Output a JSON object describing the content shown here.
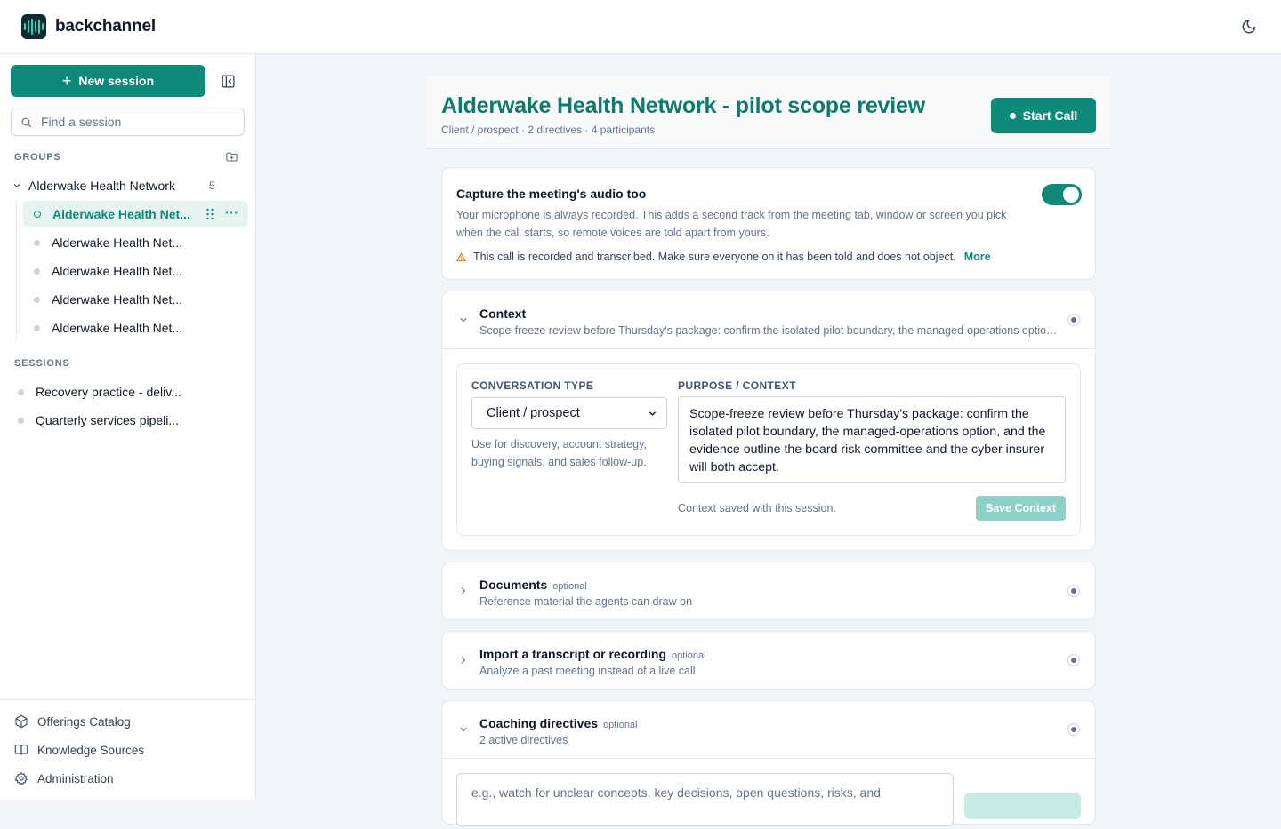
{
  "app": {
    "name": "backchannel"
  },
  "sidebar": {
    "new_session_label": "New session",
    "search_placeholder": "Find a session",
    "groups_label": "GROUPS",
    "group": {
      "name": "Alderwake Health Network",
      "count": "5",
      "sessions": [
        {
          "label": "Alderwake Health Net...",
          "active": true
        },
        {
          "label": "Alderwake Health Net...",
          "active": false
        },
        {
          "label": "Alderwake Health Net...",
          "active": false
        },
        {
          "label": "Alderwake Health Net...",
          "active": false
        },
        {
          "label": "Alderwake Health Net...",
          "active": false
        }
      ]
    },
    "sessions_label": "SESSIONS",
    "sessions": [
      {
        "label": "Recovery practice - deliv..."
      },
      {
        "label": "Quarterly services pipeli..."
      }
    ],
    "footer": [
      {
        "label": "Offerings Catalog",
        "icon": "package-icon"
      },
      {
        "label": "Knowledge Sources",
        "icon": "book-icon"
      },
      {
        "label": "Administration",
        "icon": "gear-icon"
      }
    ]
  },
  "main": {
    "title": "Alderwake Health Network - pilot scope review",
    "subtitle": "Client / prospect · 2 directives · 4 participants",
    "start_call_label": "Start Call",
    "audio": {
      "title": "Capture the meeting's audio too",
      "description": "Your microphone is always recorded. This adds a second track from the meeting tab, window or screen you pick when the call starts, so remote voices are told apart from yours.",
      "enabled": true,
      "warning": "This call is recorded and transcribed. Make sure everyone on it has been told and does not object.",
      "more_label": "More"
    },
    "context": {
      "title": "Context",
      "summary": "Scope-freeze review before Thursday's package: confirm the isolated pilot boundary, the managed-operations option, and the evidence outline the board risk committee and the cyber insurer will both accept.",
      "type_label": "CONVERSATION TYPE",
      "type_value": "Client / prospect",
      "type_help": "Use for discovery, account strategy, buying signals, and sales follow-up.",
      "purpose_label": "PURPOSE / CONTEXT",
      "purpose_value": "Scope-freeze review before Thursday's package: confirm the isolated pilot boundary, the managed-operations option, and the evidence outline the board risk committee and the cyber insurer will both accept.",
      "saved_note": "Context saved with this session.",
      "save_label": "Save Context"
    },
    "documents": {
      "title": "Documents",
      "optional": "optional",
      "subtitle": "Reference material the agents can draw on"
    },
    "import": {
      "title": "Import a transcript or recording",
      "optional": "optional",
      "subtitle": "Analyze a past meeting instead of a live call"
    },
    "coaching": {
      "title": "Coaching directives",
      "optional": "optional",
      "subtitle": "2 active directives",
      "input_placeholder": "e.g., watch for unclear concepts, key decisions, open questions, risks, and"
    }
  },
  "colors": {
    "accent": "#0f8a7a",
    "accent_light": "#e6f4f1",
    "border": "#e2e8f0",
    "muted_text": "#64748b"
  }
}
